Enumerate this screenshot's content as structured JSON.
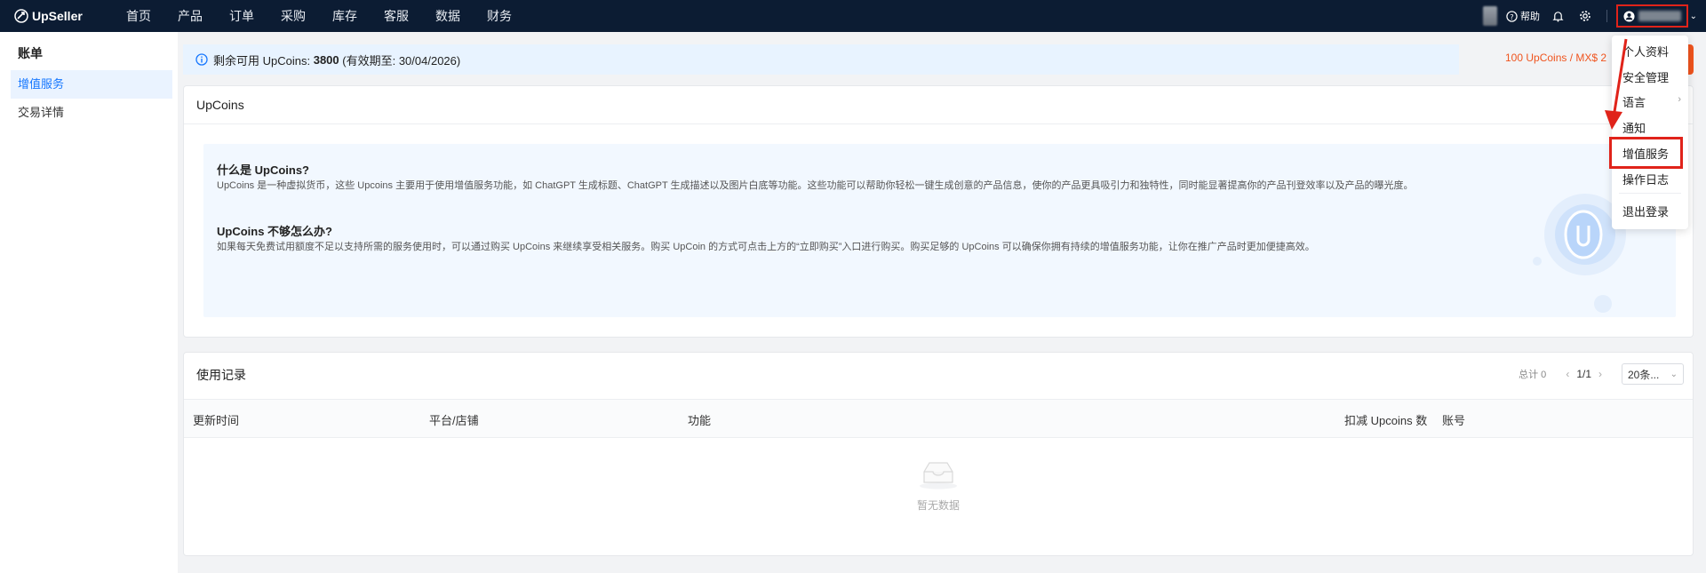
{
  "app": {
    "name": "UpSeller"
  },
  "nav": [
    "首页",
    "产品",
    "订单",
    "采购",
    "库存",
    "客服",
    "数据",
    "财务"
  ],
  "topright": {
    "help": "帮助"
  },
  "sidebar": {
    "title": "账单",
    "items": [
      {
        "label": "增值服务",
        "active": true
      },
      {
        "label": "交易详情",
        "active": false
      }
    ]
  },
  "info": {
    "prefix": "剩余可用 UpCoins:",
    "amount": "3800",
    "expiry": "(有效期至: 30/04/2026)"
  },
  "promo": "100 UpCoins / MX$ 2",
  "upcoins_card": {
    "title": "UpCoins",
    "q1_title": "什么是 UpCoins?",
    "q1_body": "UpCoins 是一种虚拟货币，这些 Upcoins 主要用于使用增值服务功能，如 ChatGPT 生成标题、ChatGPT 生成描述以及图片白底等功能。这些功能可以帮助你轻松一键生成创意的产品信息，使你的产品更具吸引力和独特性，同时能显著提高你的产品刊登效率以及产品的曝光度。",
    "q2_title": "UpCoins 不够怎么办?",
    "q2_body": "如果每天免费试用额度不足以支持所需的服务使用时，可以通过购买 UpCoins 来继续享受相关服务。购买 UpCoin 的方式可点击上方的“立即购买”入口进行购买。购买足够的 UpCoins 可以确保你拥有持续的增值服务功能，让你在推广产品时更加便捷高效。"
  },
  "records": {
    "title": "使用记录",
    "total": "总计 0",
    "page": "1/1",
    "page_size": "20条...",
    "columns": [
      "更新时间",
      "平台/店铺",
      "功能",
      "扣减 Upcoins 数",
      "账号"
    ],
    "empty_text": "暂无数据"
  },
  "user_menu": [
    "个人资料",
    "安全管理",
    "语言",
    "通知",
    "增值服务",
    "操作日志",
    "退出登录"
  ],
  "colors": {
    "topbar": "#0c1c33",
    "accent": "#1677ff",
    "promo": "#f0541e",
    "highlight": "#e0231a"
  }
}
